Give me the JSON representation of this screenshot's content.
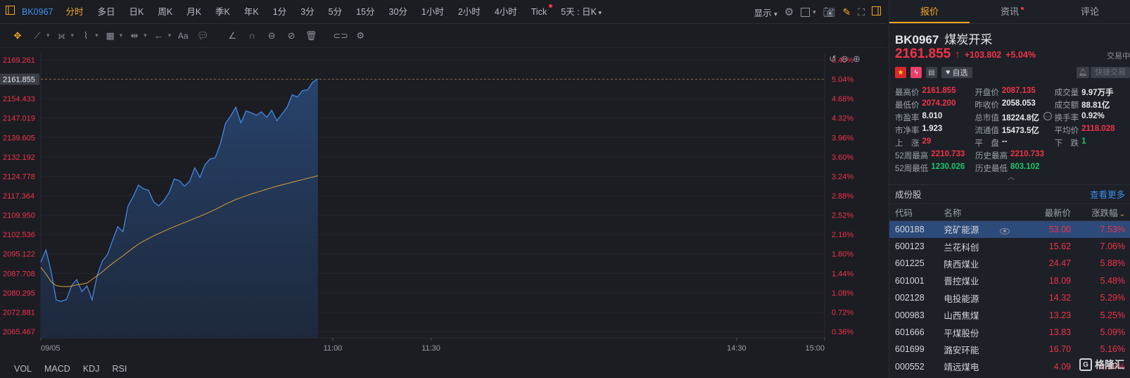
{
  "topbar": {
    "code": "BK0967",
    "periods": [
      {
        "label": "分时",
        "active": true
      },
      {
        "label": "多日"
      },
      {
        "label": "日K"
      },
      {
        "label": "周K"
      },
      {
        "label": "月K"
      },
      {
        "label": "季K"
      },
      {
        "label": "年K"
      },
      {
        "label": "1分"
      },
      {
        "label": "3分"
      },
      {
        "label": "5分"
      },
      {
        "label": "15分"
      },
      {
        "label": "30分"
      },
      {
        "label": "1小时"
      },
      {
        "label": "2小时"
      },
      {
        "label": "4小时"
      },
      {
        "label": "Tick",
        "dot": true
      },
      {
        "label": "5天 : 日K",
        "chevron": true
      }
    ],
    "display_label": "显示"
  },
  "indicators": [
    "VOL",
    "MACD",
    "KDJ",
    "RSI"
  ],
  "chart_data": {
    "type": "line",
    "date_label": "09/05",
    "x_ticks": [
      "09/05",
      "11:00",
      "11:30",
      "14:30",
      "15:00"
    ],
    "y_ticks_left": [
      "2169.261",
      "2161.855",
      "2154.433",
      "2147.019",
      "2139.605",
      "2132.192",
      "2124.778",
      "2117.364",
      "2109.950",
      "2102.536",
      "2095.122",
      "2087.708",
      "2080.295",
      "2072.881",
      "2065.467"
    ],
    "y_ticks_right": [
      "5.40%",
      "5.04%",
      "4.68%",
      "4.32%",
      "3.96%",
      "3.60%",
      "3.24%",
      "2.88%",
      "2.52%",
      "2.16%",
      "1.80%",
      "1.44%",
      "1.08%",
      "0.72%",
      "0.36%"
    ],
    "ylim": [
      2065.467,
      2169.261
    ],
    "current_price": 2161.855,
    "series": [
      {
        "values": [
          2092.0,
          2096.6,
          2088.5,
          2077.5,
          2077.0,
          2077.7,
          2083.0,
          2085.3,
          2080.7,
          2082.9,
          2077.6,
          2087.0,
          2092.4,
          2094.9,
          2100.4,
          2105.5,
          2103.6,
          2113.5,
          2117.0,
          2121.4,
          2120.0,
          2119.4,
          2115.0,
          2113.5,
          2115.5,
          2118.5,
          2123.8,
          2123.1,
          2121.0,
          2122.9,
          2128.0,
          2124.4,
          2129.2,
          2131.4,
          2131.9,
          2137.2,
          2145.0,
          2147.8,
          2151.2,
          2145.2,
          2149.7,
          2149.1,
          2148.1,
          2149.4,
          2147.3,
          2150.0,
          2146.0,
          2148.6,
          2151.1,
          2155.9,
          2155.1,
          2157.5,
          2157.8,
          2160.8,
          2161.9
        ]
      },
      {
        "values": [
          2090.0,
          2087.5,
          2084.5,
          2083.0,
          2082.7,
          2082.6,
          2082.8,
          2083.3,
          2083.6,
          2084.0,
          2085.4,
          2086.8,
          2088.3,
          2090.0,
          2091.5,
          2093.0,
          2094.4,
          2095.9,
          2097.4,
          2098.8,
          2100.0,
          2101.0,
          2102.0,
          2102.9,
          2103.8,
          2104.7,
          2105.5,
          2106.3,
          2107.1,
          2107.9,
          2108.7,
          2109.5,
          2110.3,
          2111.2,
          2112.1,
          2113.1,
          2114.1,
          2115.0,
          2115.9,
          2116.6,
          2117.3,
          2118.0,
          2118.6,
          2119.2,
          2119.8,
          2120.4,
          2121.0,
          2121.5,
          2122.0,
          2122.5,
          2123.0,
          2123.5,
          2124.0,
          2124.5,
          2125.0
        ]
      }
    ]
  },
  "panel": {
    "tabs": [
      {
        "label": "报价",
        "active": true
      },
      {
        "label": "资讯",
        "dot": true
      },
      {
        "label": "评论"
      }
    ],
    "code": "BK0967",
    "name": "煤炭开采",
    "price": "2161.855",
    "change": "+103.802",
    "change_pct": "+5.04%",
    "status": "交易中",
    "watch_label": "自选",
    "quick_trade": "快捷交易",
    "stats": [
      [
        {
          "label": "最高价",
          "value": "2161.855",
          "color": "red"
        },
        {
          "label": "开盘价",
          "value": "2087.135",
          "color": "red"
        },
        {
          "label": "成交量",
          "value": "9.97万手"
        }
      ],
      [
        {
          "label": "最低价",
          "value": "2074.200",
          "color": "red"
        },
        {
          "label": "昨收价",
          "value": "2058.053"
        },
        {
          "label": "成交额",
          "value": "88.81亿"
        }
      ],
      [
        {
          "label": "市盈率",
          "value": "8.010"
        },
        {
          "label": "总市值",
          "value": "18224.8亿",
          "info": true
        },
        {
          "label": "换手率",
          "value": "0.92%"
        }
      ],
      [
        {
          "label": "市净率",
          "value": "1.923"
        },
        {
          "label": "流通值",
          "value": "15473.5亿"
        },
        {
          "label": "平均价",
          "value": "2118.028",
          "color": "red"
        }
      ],
      [
        {
          "label": "上　涨",
          "value": "29",
          "color": "red"
        },
        {
          "label": "平　盘",
          "value": "--"
        },
        {
          "label": "下　跌",
          "value": "1",
          "color": "green"
        }
      ],
      [
        {
          "label": "52周最高",
          "value": "2210.733",
          "color": "red"
        },
        {
          "label": "历史最高",
          "value": "2210.733",
          "color": "red"
        }
      ],
      [
        {
          "label": "52周最低",
          "value": "1230.026",
          "color": "green"
        },
        {
          "label": "历史最低",
          "value": "803.102",
          "color": "green"
        }
      ]
    ],
    "constituents_title": "成份股",
    "more_label": "查看更多",
    "table_headers": [
      "代码",
      "名称",
      "最新价",
      "涨跌幅"
    ],
    "rows": [
      {
        "code": "600188",
        "name": "兖矿能源",
        "price": "53.00",
        "pct": "7.53%",
        "selected": true
      },
      {
        "code": "600123",
        "name": "兰花科创",
        "price": "15.62",
        "pct": "7.06%"
      },
      {
        "code": "601225",
        "name": "陕西煤业",
        "price": "24.47",
        "pct": "5.88%"
      },
      {
        "code": "601001",
        "name": "晋控煤业",
        "price": "18.09",
        "pct": "5.48%"
      },
      {
        "code": "002128",
        "name": "电投能源",
        "price": "14.32",
        "pct": "5.29%"
      },
      {
        "code": "000983",
        "name": "山西焦煤",
        "price": "13.23",
        "pct": "5.25%"
      },
      {
        "code": "601666",
        "name": "平煤股份",
        "price": "13.83",
        "pct": "5.09%"
      },
      {
        "code": "601699",
        "name": "潞安环能",
        "price": "16.70",
        "pct": "5.16%"
      },
      {
        "code": "000552",
        "name": "靖远煤电",
        "price": "4.09",
        "pct": "4.87%"
      }
    ],
    "logo_text": "格隆汇"
  },
  "colors": {
    "up": "#f0334a",
    "down": "#1fc36c",
    "accent": "#f5a623",
    "link": "#3d8ef0",
    "price_line": "#4a8df0",
    "avg_line": "#d8a13a"
  }
}
